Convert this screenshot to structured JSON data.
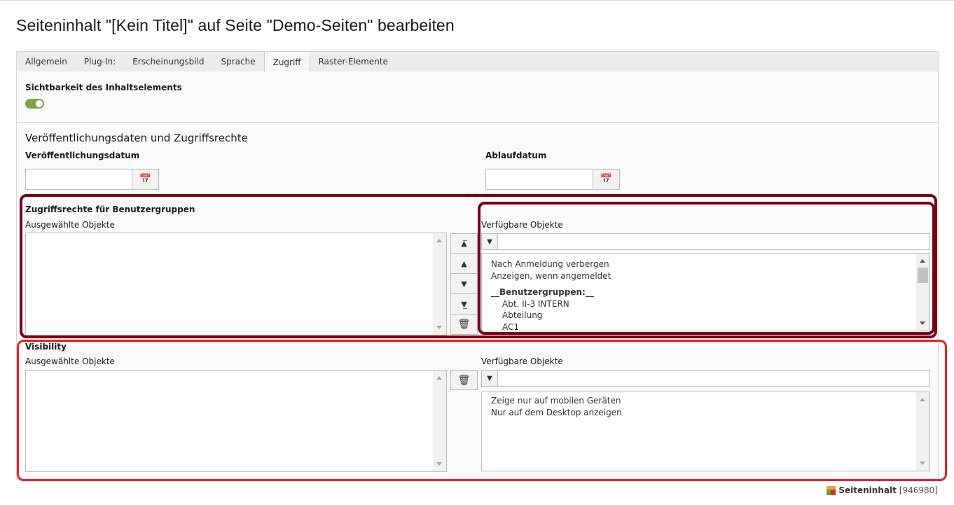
{
  "page": {
    "title": "Seiteninhalt \"[Kein Titel]\" auf Seite \"Demo-Seiten\" bearbeiten"
  },
  "tabs": [
    {
      "label": "Allgemein",
      "active": false
    },
    {
      "label": "Plug-In:",
      "active": false
    },
    {
      "label": "Erscheinungsbild",
      "active": false
    },
    {
      "label": "Sprache",
      "active": false
    },
    {
      "label": "Zugriff",
      "active": true
    },
    {
      "label": "Raster-Elemente",
      "active": false
    }
  ],
  "visibility_toggle": {
    "label": "Sichtbarkeit des Inhaltselements",
    "enabled": true,
    "color": "#79a548"
  },
  "publishing": {
    "heading": "Veröffentlichungsdaten und Zugriffsrechte",
    "start_label": "Veröffentlichungsdatum",
    "start_value": "",
    "end_label": "Ablaufdatum",
    "end_value": "",
    "calendar_icon": "calendar-icon"
  },
  "access_groups": {
    "label": "Zugriffsrechte für Benutzergruppen",
    "selected_label": "Ausgewählte Objekte",
    "available_label": "Verfügbare Objekte",
    "filter_value": "",
    "buttons": [
      "move-to-top-icon",
      "move-up-icon",
      "move-down-icon",
      "move-to-bottom-icon",
      "trash-icon"
    ],
    "available_items": [
      "Nach Anmeldung verbergen",
      "Anzeigen, wenn angemeldet",
      "__Benutzergruppen:__",
      "Abt. II-3 INTERN",
      "Abteilung",
      "AC1"
    ],
    "highlight_color": "#7a0016"
  },
  "visibility": {
    "label": "Visibility",
    "selected_label": "Ausgewählte Objekte",
    "available_label": "Verfügbare Objekte",
    "filter_value": "",
    "buttons": [
      "trash-icon"
    ],
    "available_items": [
      "Zeige nur auf mobilen Geräten",
      "Nur auf dem Desktop anzeigen"
    ],
    "highlight_color": "#e8202a"
  },
  "footer": {
    "record_type": "Seiteninhalt",
    "record_id": "[946980]"
  }
}
